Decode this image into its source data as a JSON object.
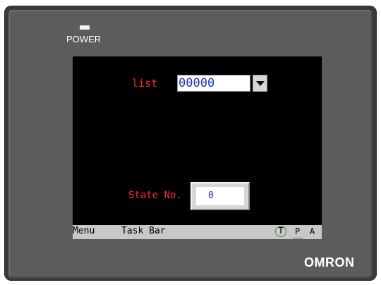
{
  "device": {
    "power_label": "POWER",
    "brand": "OMRON"
  },
  "screen": {
    "list_label": "list",
    "list_value": "00000",
    "state_label": "State No.",
    "state_value": "0"
  },
  "taskbar": {
    "menu": "Menu",
    "task_bar": "Task Bar",
    "t": "T",
    "p": "P",
    "a": "A"
  },
  "colors": {
    "label_red": "#ff2a2a",
    "value_blue": "#1c2fb8",
    "accent_green": "#2f9a3a"
  }
}
